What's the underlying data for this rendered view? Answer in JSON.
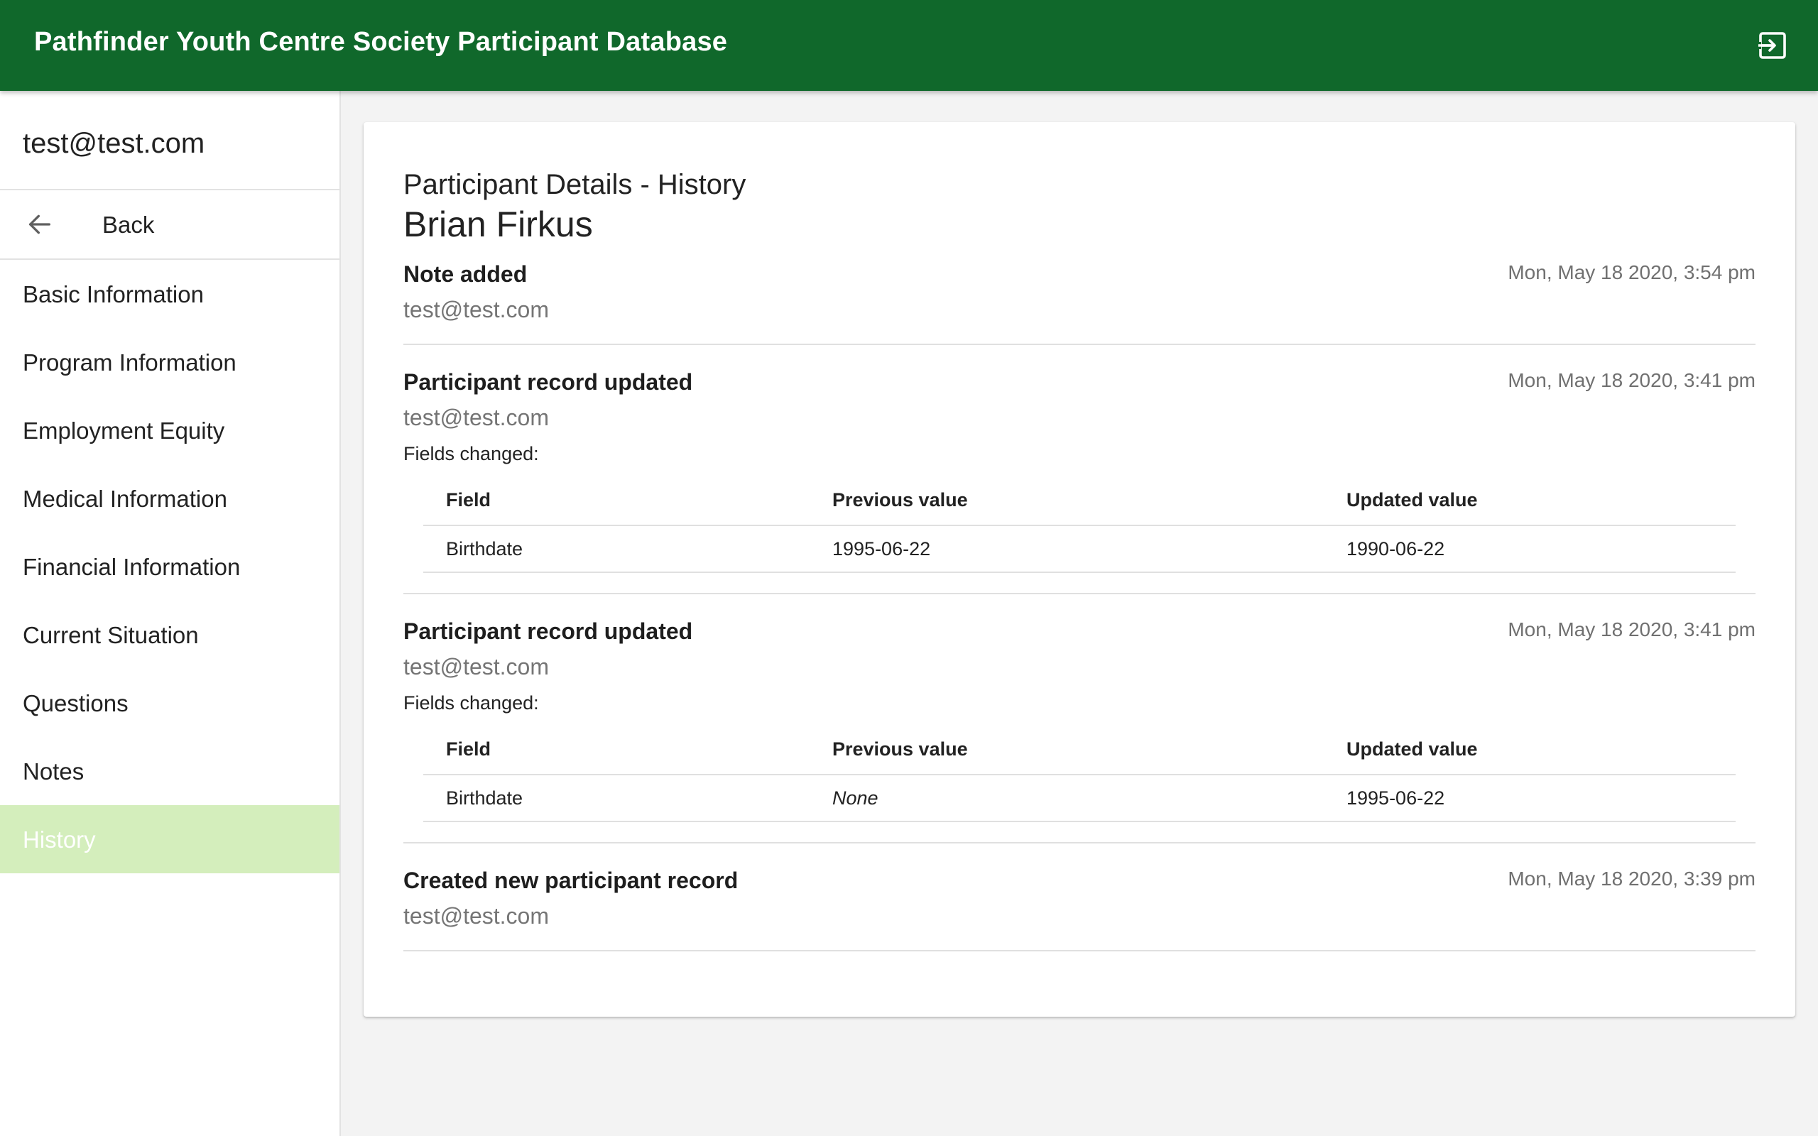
{
  "app": {
    "title": "Pathfinder Youth Centre Society Participant Database",
    "logout_icon": "logout-icon"
  },
  "drawer": {
    "user_email": "test@test.com",
    "back_label": "Back",
    "back_icon": "arrow-left-icon",
    "items": [
      {
        "label": "Basic Information",
        "active": false
      },
      {
        "label": "Program Information",
        "active": false
      },
      {
        "label": "Employment Equity",
        "active": false
      },
      {
        "label": "Medical Information",
        "active": false
      },
      {
        "label": "Financial Information",
        "active": false
      },
      {
        "label": "Current Situation",
        "active": false
      },
      {
        "label": "Questions",
        "active": false
      },
      {
        "label": "Notes",
        "active": false
      },
      {
        "label": "History",
        "active": true
      }
    ]
  },
  "main": {
    "title": "Participant Details - History",
    "participant_name": "Brian Firkus",
    "fields_changed_label": "Fields changed:",
    "table_headers": {
      "field": "Field",
      "previous": "Previous value",
      "updated": "Updated value"
    },
    "entries": [
      {
        "title": "Note added",
        "user": "test@test.com",
        "time": "Mon, May 18 2020, 3:54 pm",
        "changes": []
      },
      {
        "title": "Participant record updated",
        "user": "test@test.com",
        "time": "Mon, May 18 2020, 3:41 pm",
        "changes": [
          {
            "field": "Birthdate",
            "previous": "1995-06-22",
            "updated": "1990-06-22"
          }
        ]
      },
      {
        "title": "Participant record updated",
        "user": "test@test.com",
        "time": "Mon, May 18 2020, 3:41 pm",
        "changes": [
          {
            "field": "Birthdate",
            "previous": "None",
            "updated": "1995-06-22"
          }
        ]
      },
      {
        "title": "Created new participant record",
        "user": "test@test.com",
        "time": "Mon, May 18 2020, 3:39 pm",
        "changes": []
      }
    ]
  },
  "colors": {
    "app_bar": "#10682b",
    "active_nav": "#d4eebc"
  }
}
